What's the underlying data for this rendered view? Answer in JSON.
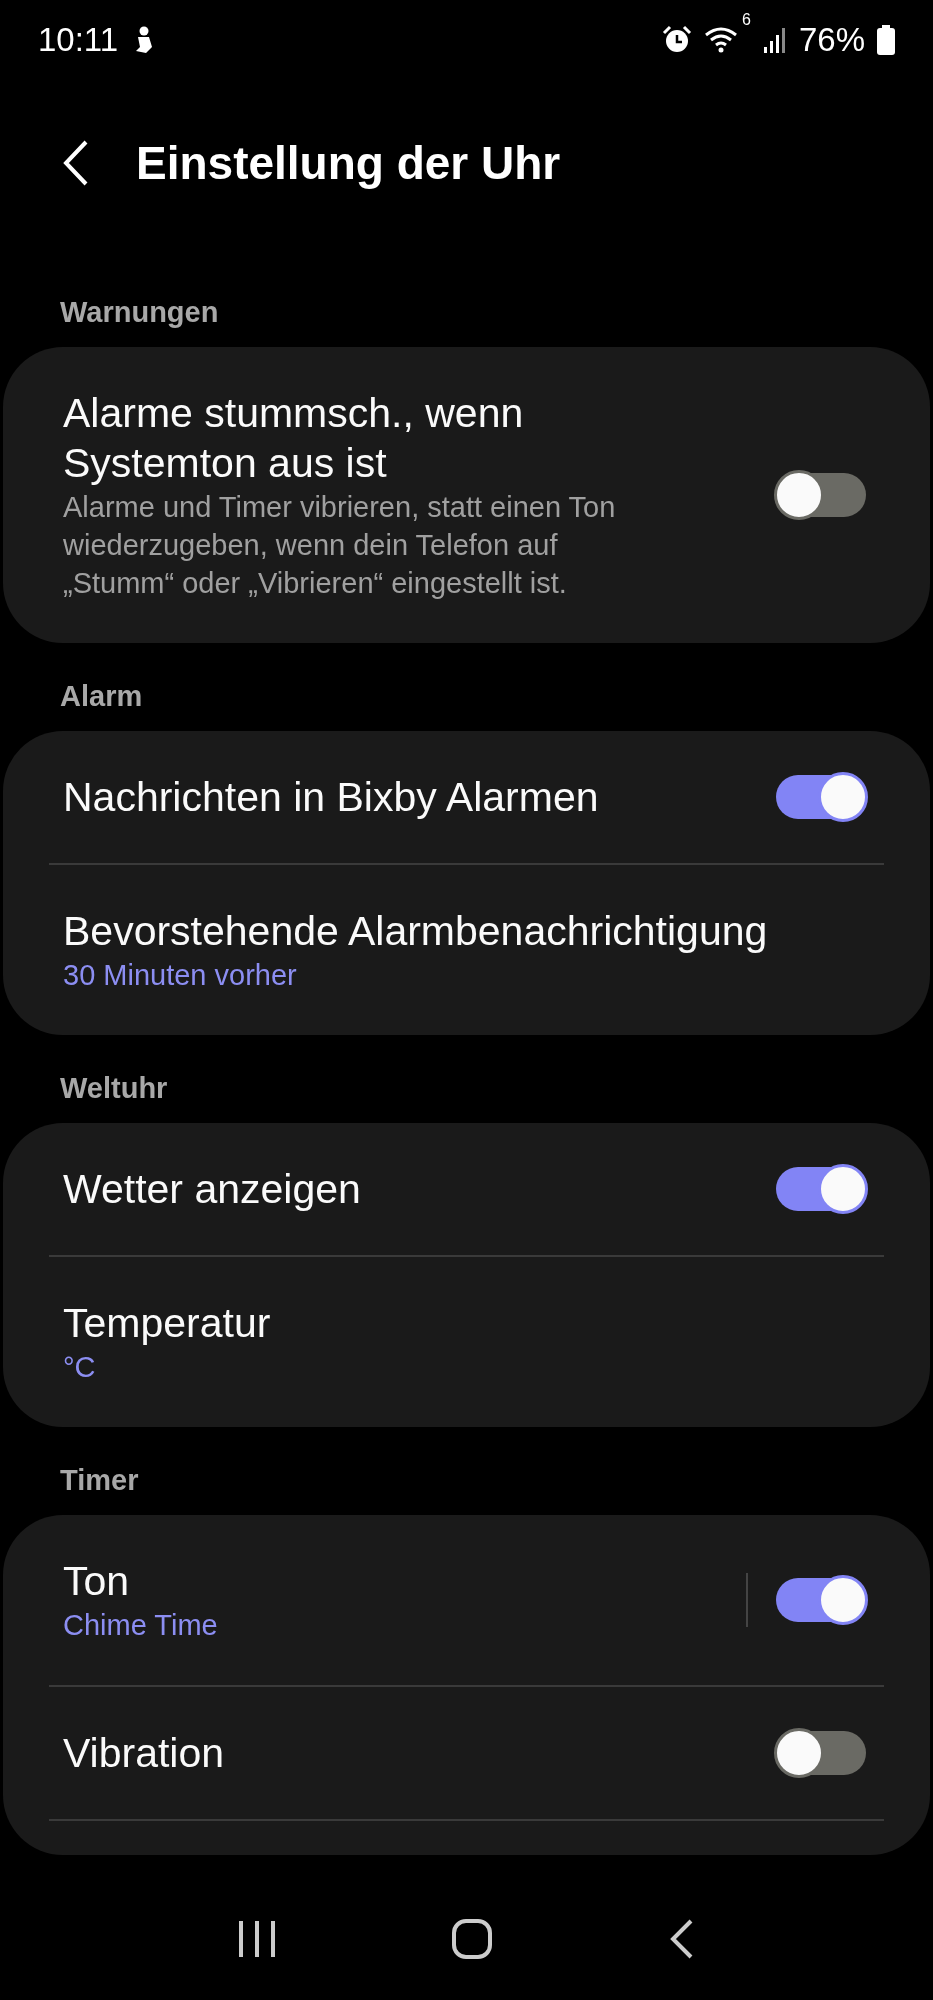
{
  "status_bar": {
    "time": "10:11",
    "wifi_badge": "6",
    "battery": "76%"
  },
  "header": {
    "title": "Einstellung der Uhr"
  },
  "sections": [
    {
      "title": "Warnungen",
      "divider_after_last": false,
      "items": [
        {
          "kind": "switch",
          "title": "Alarme stummsch., wenn Systemton aus ist",
          "description": "Alarme und Timer vibrieren, statt einen Ton wiederzugeben, wenn dein Telefon auf „Stumm“ oder „Vibrieren“ eingestellt ist.",
          "on": false
        }
      ]
    },
    {
      "title": "Alarm",
      "divider_after_last": false,
      "items": [
        {
          "kind": "switch",
          "title": "Nachrichten in Bixby Alarmen",
          "on": true
        },
        {
          "kind": "link",
          "title": "Bevorstehende Alarmbenachrichtigung",
          "summary": "30 Minuten vorher"
        }
      ]
    },
    {
      "title": "Weltuhr",
      "divider_after_last": false,
      "items": [
        {
          "kind": "switch",
          "title": "Wetter anzeigen",
          "on": true
        },
        {
          "kind": "link",
          "title": "Temperatur",
          "summary": "°C"
        }
      ]
    },
    {
      "title": "Timer",
      "divider_after_last": true,
      "items": [
        {
          "kind": "split_switch",
          "title": "Ton",
          "summary": "Chime Time",
          "on": true
        },
        {
          "kind": "switch",
          "title": "Vibration",
          "on": false
        }
      ]
    }
  ]
}
